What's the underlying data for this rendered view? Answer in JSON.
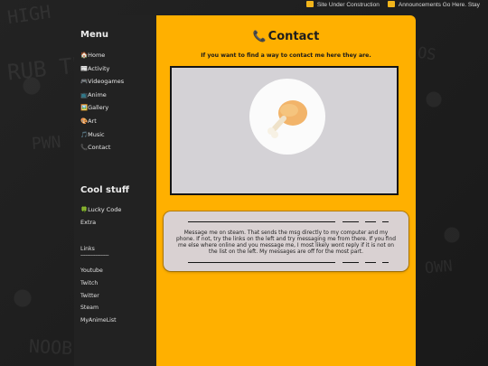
{
  "marquee": {
    "items": [
      "Site Under Construction",
      "Announcements Go Here. Stay"
    ],
    "icon": "announcement-icon"
  },
  "sidebar": {
    "menu_title": "Menu",
    "menu_items": [
      {
        "label": "🏠Home"
      },
      {
        "label": "📰Activity"
      },
      {
        "label": "🎮Videogames"
      },
      {
        "label": "📺Anime"
      },
      {
        "label": "🖼️Gallery"
      },
      {
        "label": "🎨Art"
      },
      {
        "label": "🎵Music"
      },
      {
        "label": "📞Contact"
      }
    ],
    "cool_title": "Cool stuff",
    "cool_items": [
      {
        "label": "🍀Lucky Code"
      },
      {
        "label": "Extra"
      }
    ],
    "links_title": "Links",
    "links_divider": "-----------------",
    "links": [
      {
        "label": "Youtube"
      },
      {
        "label": "Twitch"
      },
      {
        "label": "Twitter"
      },
      {
        "label": "Steam"
      },
      {
        "label": "MyAnimeList"
      }
    ]
  },
  "content": {
    "title": "Contact",
    "title_icon": "📞",
    "subtitle": "If you want to find a way to contact me here they are.",
    "image": {
      "name": "chicken-drumstick-icon"
    },
    "message": "Message me on steam. That sends the msg directly to my computer and my phone. If not, try the links on the left and try messaging me from there. If you find me else where online and you message me, I most likely wont reply if it is not on the list on the left. My messages are off for the most part."
  },
  "colors": {
    "page_bg": "#1c1c1c",
    "sidebar_bg": "#222222",
    "content_bg": "#ffb000",
    "card_bg": "#d9d1d2",
    "picture_bg": "#d4d2d6"
  }
}
